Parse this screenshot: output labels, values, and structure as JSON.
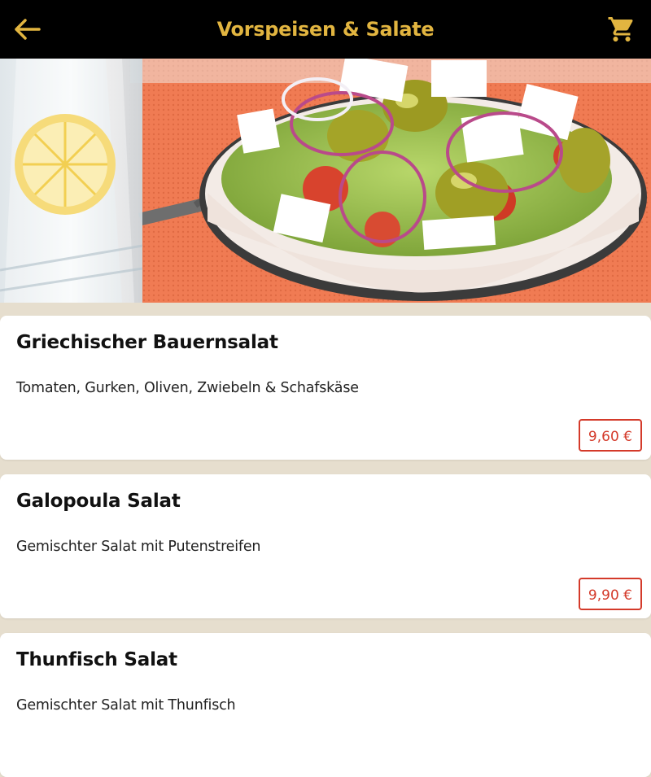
{
  "header": {
    "title": "Vorspeisen & Salate",
    "back_icon": "arrow-left-icon",
    "cart_icon": "shopping-cart-icon",
    "background_color": "#000000",
    "accent_color": "#e2b540"
  },
  "hero": {
    "image": "greek-salad-photo"
  },
  "menu": {
    "price_color": "#d43a2a",
    "items": [
      {
        "name": "Griechischer Bauernsalat",
        "description": "Tomaten, Gurken, Oliven, Zwiebeln & Schafskäse",
        "price": "9,60 €"
      },
      {
        "name": "Galopoula Salat",
        "description": "Gemischter Salat mit Putenstreifen",
        "price": "9,90 €"
      },
      {
        "name": "Thunfisch Salat",
        "description": "Gemischter Salat mit Thunfisch",
        "price": ""
      }
    ]
  }
}
